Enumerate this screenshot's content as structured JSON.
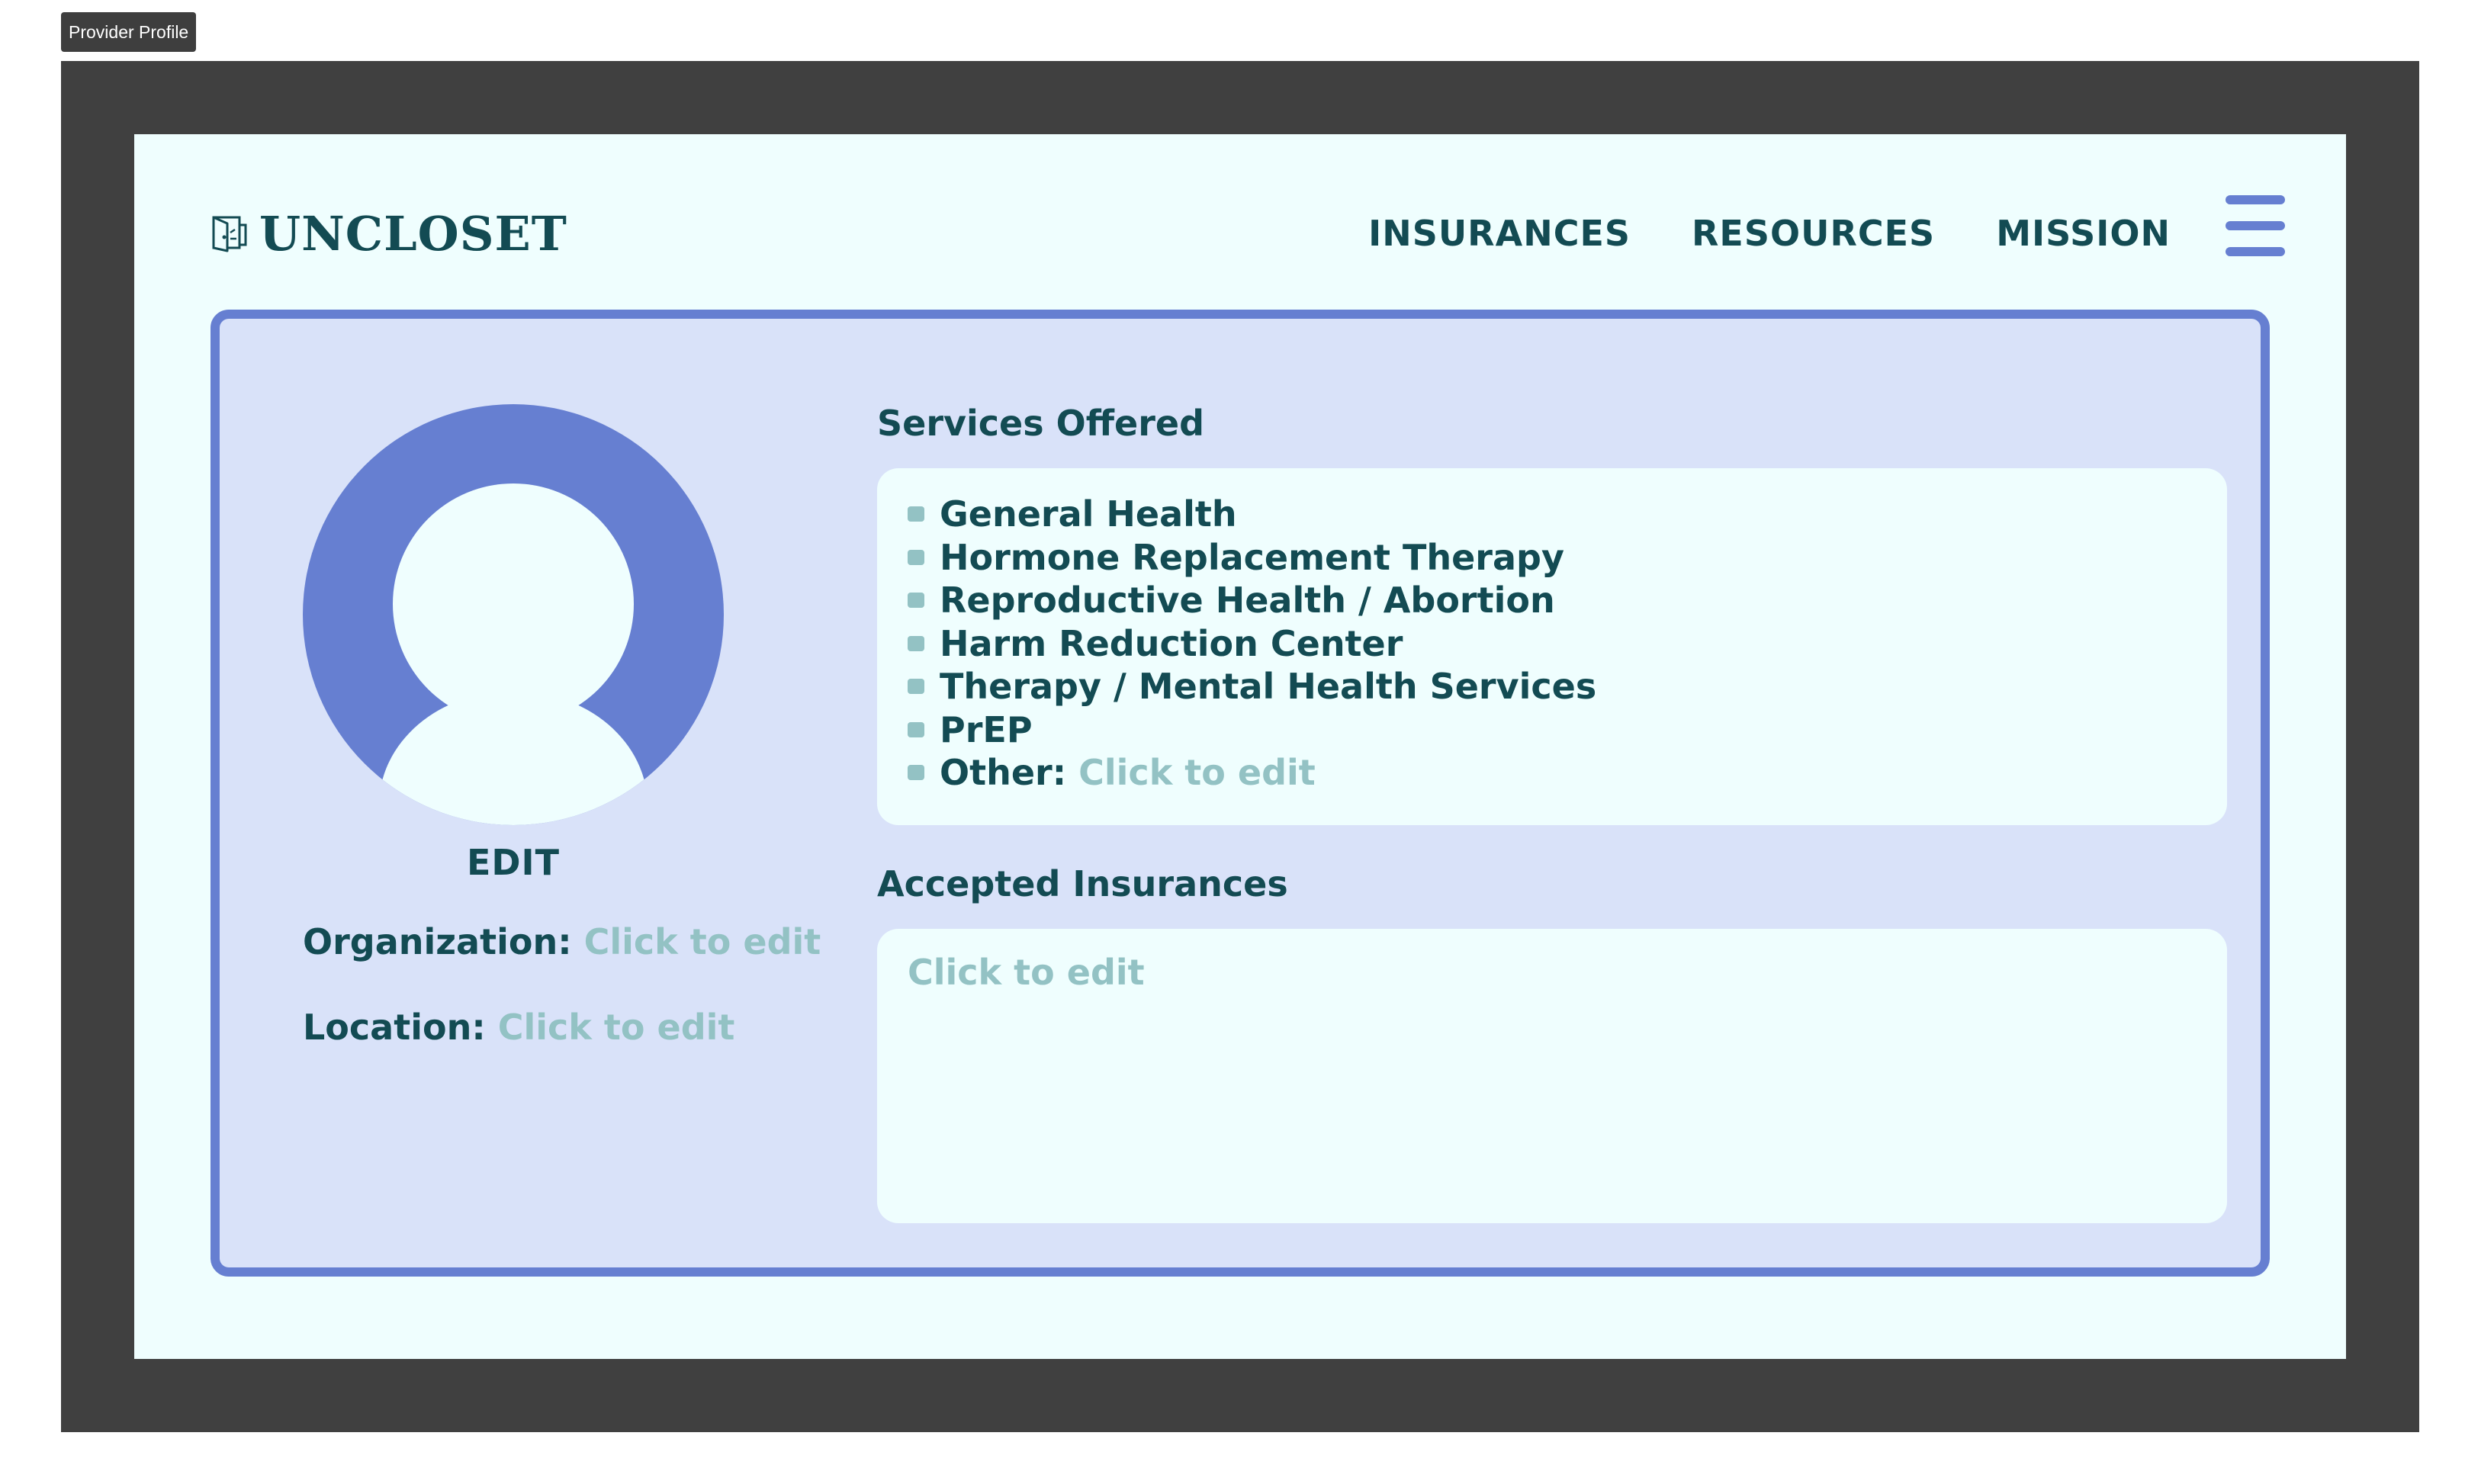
{
  "window": {
    "tag": "Provider Profile"
  },
  "brand": {
    "name": "UNCLOSET",
    "icon": "closet-door-icon"
  },
  "nav": {
    "links": [
      "INSURANCES",
      "RESOURCES",
      "MISSION"
    ],
    "menu_icon": "hamburger-menu-icon"
  },
  "profile": {
    "avatar_icon": "user-avatar-icon",
    "edit_label": "EDIT",
    "organization_label": "Organization:",
    "organization_value": "Click to edit",
    "location_label": "Location:",
    "location_value": "Click to edit"
  },
  "services": {
    "title": "Services Offered",
    "items": [
      "General Health",
      "Hormone Replacement Therapy",
      "Reproductive Health / Abortion",
      "Harm Reduction Center",
      "Therapy / Mental Health Services",
      "PrEP"
    ],
    "other_label": "Other:",
    "other_value": "Click to edit"
  },
  "insurances": {
    "title": "Accepted Insurances",
    "value": "Click to edit"
  },
  "colors": {
    "frame": "#404040",
    "page_bg": "#effefe",
    "card_bg": "#d9e2f9",
    "accent": "#667fd1",
    "text": "#134b53",
    "placeholder": "#93c2c4"
  }
}
